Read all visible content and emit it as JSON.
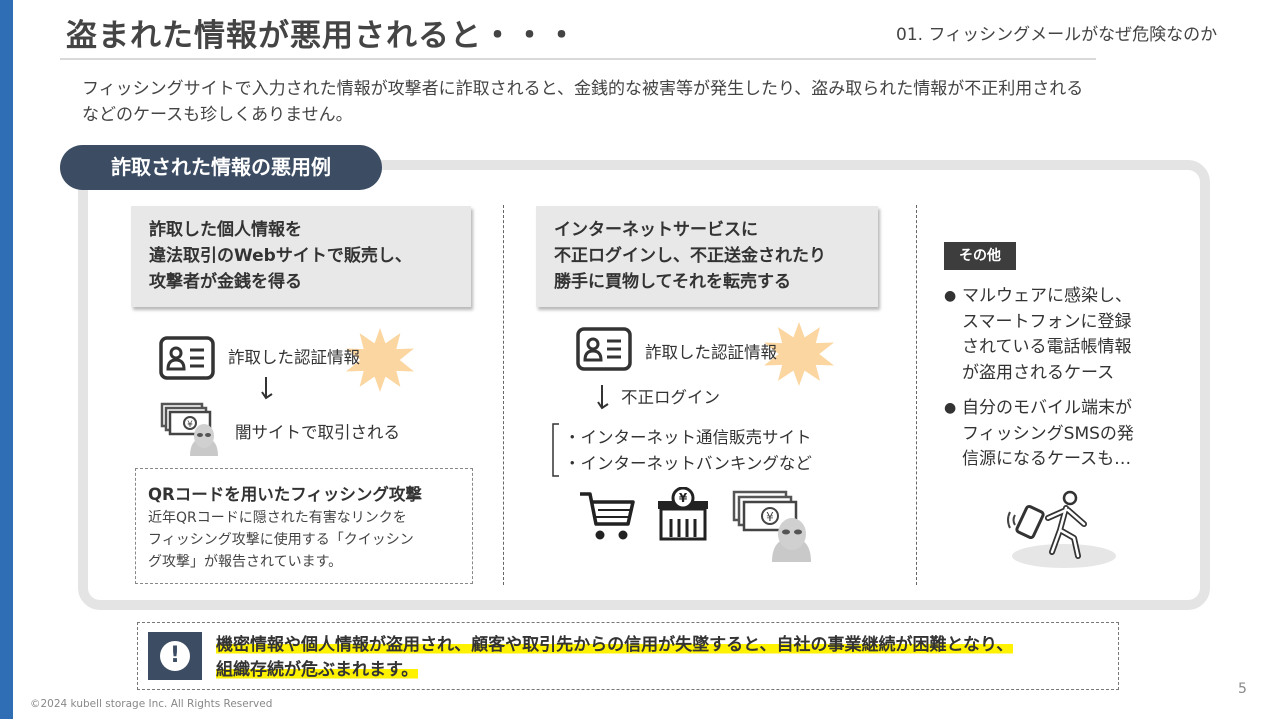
{
  "header": {
    "title": "盗まれた情報が悪用されると・・・",
    "section": "01. フィッシングメールがなぜ危険なのか"
  },
  "intro": {
    "line1": "フィッシングサイトで入力された情報が攻撃者に詐取されると、金銭的な被害等が発生したり、盗み取られた情報が不正利用される",
    "line2": "などのケースも珍しくありません。"
  },
  "examples": {
    "heading": "詐取された情報の悪用例",
    "col1": {
      "box": [
        "詐取した個人情報を",
        "違法取引のWebサイトで販売し、",
        "攻撃者が金銭を得る"
      ],
      "credential": "詐取した認証情報",
      "dark_site": "闇サイトで取引される",
      "qr": {
        "title": "QRコードを用いたフィッシング攻撃",
        "body": [
          "近年QRコードに隠された有害なリンクを",
          "フィッシング攻撃に使用する「クイッシン",
          "グ攻撃」が報告されています。"
        ]
      }
    },
    "col2": {
      "box": [
        "インターネットサービスに",
        "不正ログインし、不正送金されたり",
        "勝手に買物してそれを転売する"
      ],
      "credential": "詐取した認証情報",
      "login": "不正ログイン",
      "targets": [
        "・インターネット通信販売サイト",
        "・インターネットバンキングなど"
      ]
    },
    "col3": {
      "tag": "その他",
      "bullet": "●",
      "items": [
        [
          "マルウェアに感染し、",
          "スマートフォンに登録",
          "されている電話帳情報",
          "が盗用されるケース"
        ],
        [
          "自分のモバイル端末が",
          "フィッシングSMSの発",
          "信源になるケースも…"
        ]
      ]
    }
  },
  "alert": {
    "icon": "exclamation-icon",
    "line1": "機密情報や個人情報が盗用され、顧客や取引先からの信用が失墜すると、自社の事業継続が困難となり、",
    "line2": "組織存続が危ぶまれます。"
  },
  "footer": {
    "page": "5",
    "copyright": "©2024 kubell storage Inc. All Rights Reserved"
  },
  "colors": {
    "accent_bar": "#2f6eb5",
    "pill": "#3c4d63",
    "highlight": "#fff200",
    "burst": "#fbd6a0"
  }
}
